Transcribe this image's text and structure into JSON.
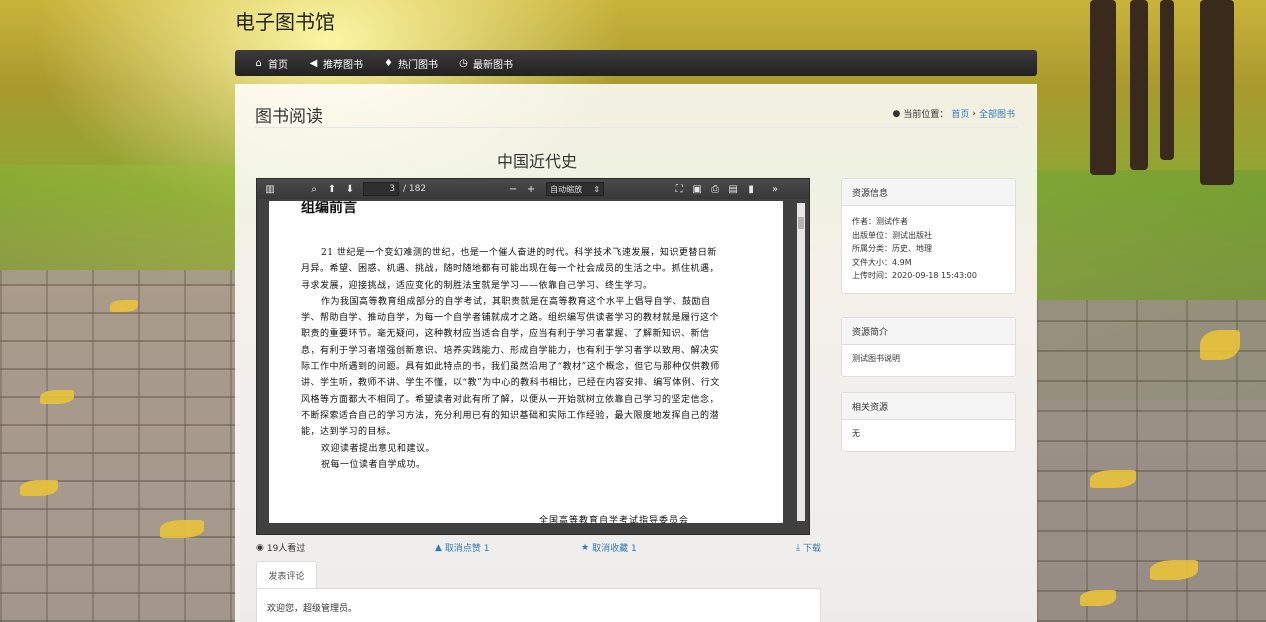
{
  "site": {
    "title": "电子图书馆"
  },
  "nav": [
    {
      "icon": "home-icon",
      "glyph": "⌂",
      "label": "首页"
    },
    {
      "icon": "bullhorn-icon",
      "glyph": "📢",
      "label": "推荐图书"
    },
    {
      "icon": "fire-icon",
      "glyph": "♨",
      "label": "热门图书"
    },
    {
      "icon": "clock-icon",
      "glyph": "◷",
      "label": "最新图书"
    }
  ],
  "page": {
    "title": "图书阅读",
    "breadcrumb_label": "当前位置：",
    "breadcrumb": [
      "首页",
      "全部图书"
    ]
  },
  "book": {
    "title": "中国近代史"
  },
  "pdf": {
    "current_page": "3",
    "total_pages": "/ 182",
    "zoom": "自动缩放",
    "heading": "组编前言",
    "paragraphs": [
      "21 世纪是一个变幻难测的世纪，也是一个催人奋进的时代。科学技术飞速发展，知识更替日新月异。希望、困惑、机遇、挑战，随时随地都有可能出现在每一个社会成员的生活之中。抓住机遇，寻求发展，迎接挑战，适应变化的制胜法宝就是学习——依靠自己学习、终生学习。",
      "作为我国高等教育组成部分的自学考试，其职责就是在高等教育这个水平上倡导自学、鼓励自学、帮助自学、推动自学，为每一个自学者铺就成才之路。组织编写供读者学习的教材就是履行这个职责的重要环节。毫无疑问，这种教材应当适合自学，应当有利于学习者掌握、了解新知识、新信息，有利于学习者增强创新意识、培养实践能力、形成自学能力，也有利于学习者学以致用、解决实际工作中所遇到的问题。具有如此特点的书，我们虽然沿用了“教材”这个概念，但它与那种仅供教师讲、学生听，教师不讲、学生不懂，以“教”为中心的教科书相比，已经在内容安排、编写体例、行文风格等方面都大不相同了。希望读者对此有所了解，以便从一开始就树立依靠自己学习的坚定信念，不断探索适合自己的学习方法，充分利用已有的知识基础和实际工作经验，最大限度地发挥自己的潜能，达到学习的目标。",
      "欢迎读者提出意见和建议。",
      "祝每一位读者自学成功。"
    ],
    "footer_line": "全国高等教育自学考试指导委员会"
  },
  "actions": {
    "views": "19人看过",
    "like": "取消点赞 1",
    "favorite": "取消收藏 1",
    "download": "下载"
  },
  "comments": {
    "tab_label": "发表评论",
    "welcome": "欢迎您，超级管理员。"
  },
  "sidebar": {
    "resource_info": {
      "title": "资源信息",
      "rows": [
        "作者：测试作者",
        "出版单位：测试出版社",
        "所属分类：历史、地理",
        "文件大小：4.9M",
        "上传时间：2020-09-18 15:43:00"
      ]
    },
    "resource_intro": {
      "title": "资源简介",
      "text": "测试图书说明"
    },
    "related": {
      "title": "相关资源",
      "text": "无"
    }
  },
  "colors": {
    "link": "#337ab7",
    "navbar": "#2b2b2b",
    "pdf_toolbar": "#404040"
  }
}
